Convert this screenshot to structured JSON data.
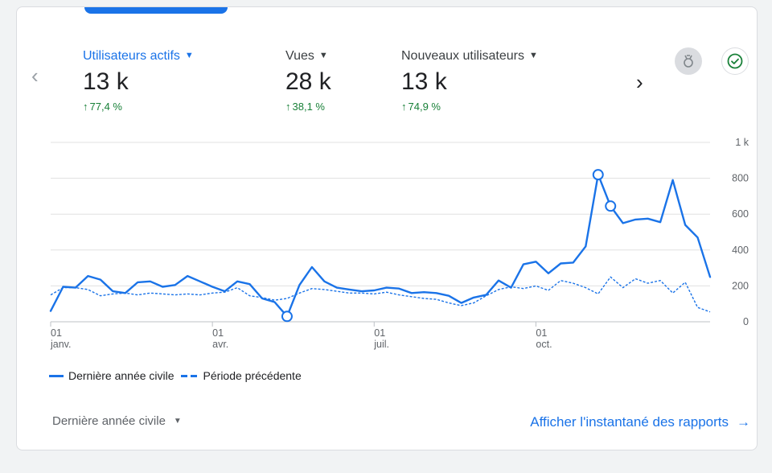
{
  "metrics": [
    {
      "label": "Utilisateurs actifs",
      "value": "13 k",
      "delta": "77,4 %",
      "active": true
    },
    {
      "label": "Vues",
      "value": "28 k",
      "delta": "38,1 %",
      "active": false
    },
    {
      "label": "Nouveaux utilisateurs",
      "value": "13 k",
      "delta": "74,9 %",
      "active": false
    }
  ],
  "icons": {
    "prev": "chevron-left-icon",
    "next": "chevron-right-icon",
    "insights": "insights-icon",
    "check": "check-circle-icon",
    "caret": "caret-down-icon",
    "link_arrow": "arrow-right-icon",
    "delta_arrow": "arrow-up-icon"
  },
  "colors": {
    "accent": "#1a73e8",
    "positive": "#188038",
    "grid": "#e0e0e0"
  },
  "legend": {
    "current": "Dernière année civile",
    "previous": "Période précédente"
  },
  "footer": {
    "period_label": "Dernière année civile",
    "report_link": "Afficher l'instantané des rapports"
  },
  "chart_data": {
    "type": "line",
    "y_ticks": [
      "1 k",
      "800",
      "600",
      "400",
      "200",
      "0"
    ],
    "y_tick_values": [
      1000,
      800,
      600,
      400,
      200,
      0
    ],
    "ylim": [
      0,
      1000
    ],
    "x_ticks": [
      {
        "day": "01",
        "month": "janv.",
        "week": 0
      },
      {
        "day": "01",
        "month": "avr.",
        "week": 13
      },
      {
        "day": "01",
        "month": "juil.",
        "week": 26
      },
      {
        "day": "01",
        "month": "oct.",
        "week": 39
      }
    ],
    "x_range": [
      0,
      53
    ],
    "grid": true,
    "legend_position": "bottom-left",
    "series": [
      {
        "name": "Dernière année civile",
        "style": "solid",
        "values": [
          60,
          195,
          190,
          255,
          235,
          170,
          160,
          220,
          225,
          195,
          205,
          255,
          225,
          195,
          170,
          225,
          210,
          130,
          110,
          30,
          205,
          305,
          225,
          190,
          180,
          170,
          175,
          190,
          185,
          160,
          165,
          160,
          145,
          105,
          135,
          150,
          230,
          190,
          320,
          335,
          270,
          325,
          330,
          420,
          820,
          645,
          550,
          570,
          575,
          555,
          790,
          540,
          470,
          250
        ],
        "markers": [
          19,
          44,
          45
        ]
      },
      {
        "name": "Période précédente",
        "style": "dashed",
        "values": [
          150,
          190,
          190,
          180,
          145,
          155,
          160,
          150,
          160,
          155,
          150,
          155,
          150,
          160,
          165,
          190,
          145,
          135,
          120,
          130,
          160,
          185,
          180,
          170,
          160,
          160,
          155,
          165,
          150,
          140,
          130,
          125,
          105,
          90,
          105,
          145,
          180,
          195,
          185,
          200,
          175,
          230,
          215,
          190,
          155,
          250,
          190,
          240,
          215,
          230,
          160,
          220,
          80,
          55
        ]
      }
    ]
  }
}
